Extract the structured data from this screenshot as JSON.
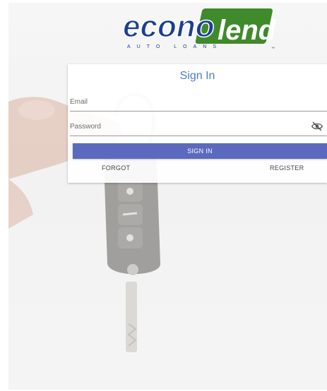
{
  "logo": {
    "word_primary": "econo",
    "word_secondary": "lend",
    "tagline": "AUTO LOANS",
    "trademark": "™",
    "colors": {
      "primary": "#1c3f8f",
      "secondary": "#3f8a2b"
    }
  },
  "signin": {
    "title": "Sign In",
    "email_placeholder": "Email",
    "email_value": "",
    "password_placeholder": "Password",
    "password_value": "",
    "visibility_icon": "eye-off-icon",
    "button_label": "SIGN IN",
    "forgot_label": "FORGOT",
    "register_label": "REGISTER",
    "colors": {
      "title": "#4a7fc8",
      "button": "#5b6abf"
    }
  }
}
